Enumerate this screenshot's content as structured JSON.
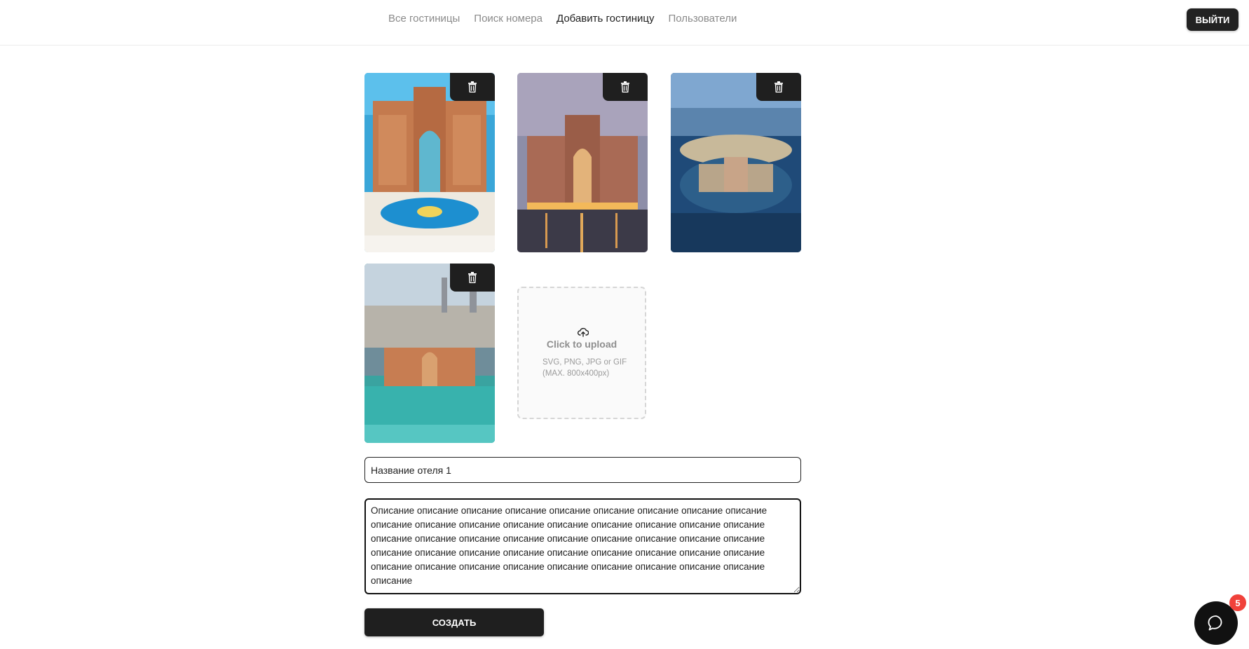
{
  "nav": {
    "items": [
      {
        "label": "Все гостиницы",
        "active": false
      },
      {
        "label": "Поиск номера",
        "active": false
      },
      {
        "label": "Добавить гостиницу",
        "active": true
      },
      {
        "label": "Пользователи",
        "active": false
      }
    ],
    "logout_label": "Выйти"
  },
  "gallery": {
    "images": [
      {
        "icon": "trash-icon"
      },
      {
        "icon": "trash-icon"
      },
      {
        "icon": "trash-icon"
      },
      {
        "icon": "trash-icon"
      }
    ],
    "upload": {
      "icon": "cloud-upload-icon",
      "title": "Click to upload",
      "hint": "SVG, PNG, JPG or GIF (MAX. 800x400px)"
    }
  },
  "form": {
    "name_value": "Название отеля 1",
    "description_value": "Описание описание описание описание описание описание описание описание описание описание описание описание описание описание описание описание описание описание описание описание описание описание описание описание описание описание описание описание описание описание описание описание описание описание описание описание описание описание описание описание описание описание описание описание описание описание",
    "create_label": "Создать"
  },
  "chat": {
    "icon": "chat-bubble-icon",
    "badge_count": "5"
  },
  "colors": {
    "primary": "#1f1f1f",
    "nav_inactive": "#8a8a8a",
    "badge": "#f0413a"
  }
}
